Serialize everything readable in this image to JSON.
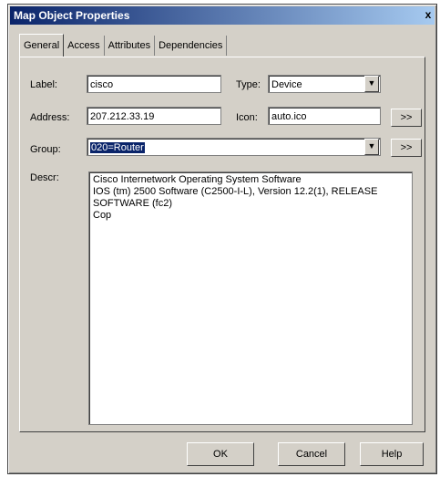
{
  "window": {
    "title": "Map Object Properties",
    "close_glyph": "x"
  },
  "tabs": [
    "General",
    "Access",
    "Attributes",
    "Dependencies"
  ],
  "general": {
    "label_caption": "Label:",
    "label_value": "cisco",
    "type_caption": "Type:",
    "type_value": "Device",
    "address_caption": "Address:",
    "address_value": "207.212.33.19",
    "icon_caption": "Icon:",
    "icon_value": "auto.ico",
    "browse_label": ">>",
    "group_caption": "Group:",
    "group_value": "020=Router",
    "group_browse_label": ">>",
    "descr_caption": "Descr:",
    "descr_text": "Cisco Internetwork Operating System Software\nIOS (tm) 2500 Software (C2500-I-L), Version 12.2(1), RELEASE\nSOFTWARE (fc2)\nCop"
  },
  "buttons": {
    "ok": "OK",
    "cancel": "Cancel",
    "help": "Help"
  },
  "icons": {
    "dropdown": "chevron-down-icon",
    "close": "close-icon"
  }
}
